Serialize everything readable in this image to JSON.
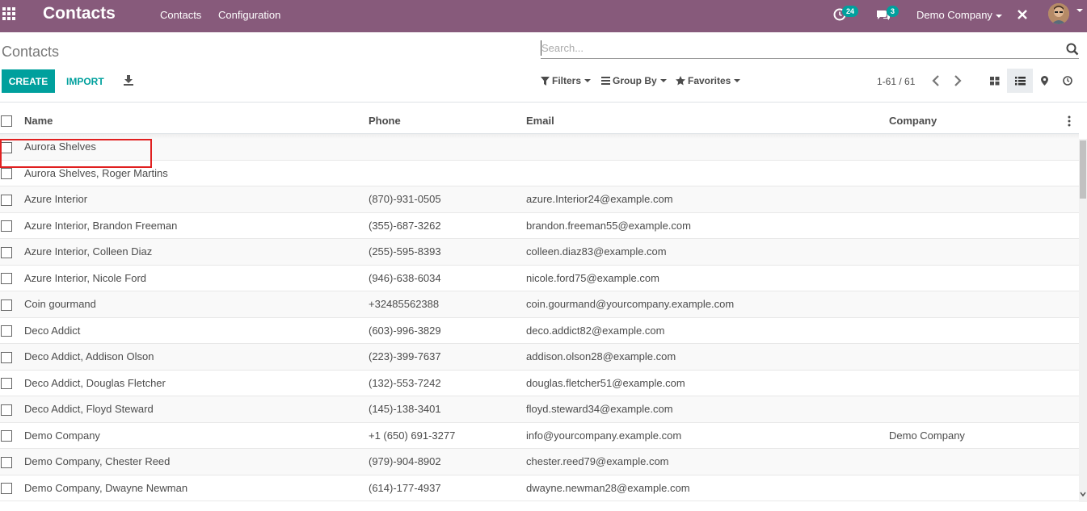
{
  "app": {
    "title": "Contacts",
    "menus": [
      "Contacts",
      "Configuration"
    ],
    "activity_count": "24",
    "messages_count": "3",
    "company": "Demo Company"
  },
  "control": {
    "breadcrumb": "Contacts",
    "search_placeholder": "Search...",
    "create_label": "CREATE",
    "import_label": "IMPORT",
    "filters_label": "Filters",
    "groupby_label": "Group By",
    "favorites_label": "Favorites",
    "pager": "1-61 / 61"
  },
  "table": {
    "headers": {
      "name": "Name",
      "phone": "Phone",
      "email": "Email",
      "company": "Company"
    },
    "rows": [
      {
        "name": "Aurora Shelves",
        "phone": "",
        "email": "",
        "company": ""
      },
      {
        "name": "Aurora Shelves, Roger Martins",
        "phone": "",
        "email": "",
        "company": ""
      },
      {
        "name": "Azure Interior",
        "phone": "(870)-931-0505",
        "email": "azure.Interior24@example.com",
        "company": ""
      },
      {
        "name": "Azure Interior, Brandon Freeman",
        "phone": "(355)-687-3262",
        "email": "brandon.freeman55@example.com",
        "company": ""
      },
      {
        "name": "Azure Interior, Colleen Diaz",
        "phone": "(255)-595-8393",
        "email": "colleen.diaz83@example.com",
        "company": ""
      },
      {
        "name": "Azure Interior, Nicole Ford",
        "phone": "(946)-638-6034",
        "email": "nicole.ford75@example.com",
        "company": ""
      },
      {
        "name": "Coin gourmand",
        "phone": "+32485562388",
        "email": "coin.gourmand@yourcompany.example.com",
        "company": ""
      },
      {
        "name": "Deco Addict",
        "phone": "(603)-996-3829",
        "email": "deco.addict82@example.com",
        "company": ""
      },
      {
        "name": "Deco Addict, Addison Olson",
        "phone": "(223)-399-7637",
        "email": "addison.olson28@example.com",
        "company": ""
      },
      {
        "name": "Deco Addict, Douglas Fletcher",
        "phone": "(132)-553-7242",
        "email": "douglas.fletcher51@example.com",
        "company": ""
      },
      {
        "name": "Deco Addict, Floyd Steward",
        "phone": "(145)-138-3401",
        "email": "floyd.steward34@example.com",
        "company": ""
      },
      {
        "name": "Demo Company",
        "phone": "+1 (650) 691-3277",
        "email": "info@yourcompany.example.com",
        "company": "Demo Company"
      },
      {
        "name": "Demo Company, Chester Reed",
        "phone": "(979)-904-8902",
        "email": "chester.reed79@example.com",
        "company": ""
      },
      {
        "name": "Demo Company, Dwayne Newman",
        "phone": "(614)-177-4937",
        "email": "dwayne.newman28@example.com",
        "company": ""
      }
    ]
  },
  "colors": {
    "navbar": "#875a7b",
    "accent": "#00a09d",
    "highlight": "#e02020"
  }
}
